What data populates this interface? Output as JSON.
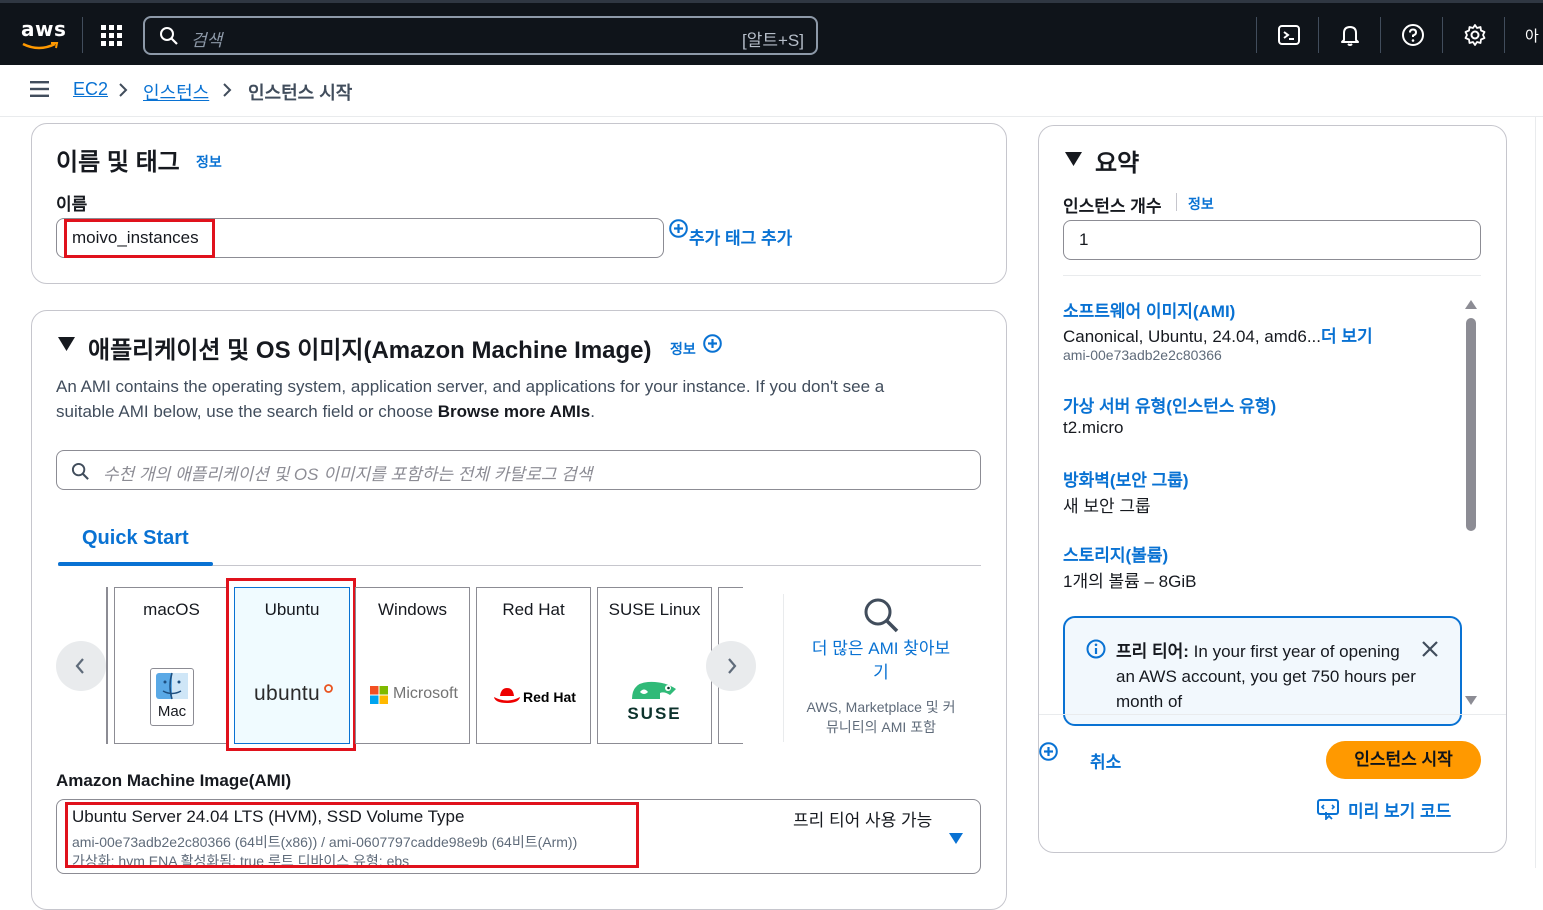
{
  "topbar": {
    "logo": "aws",
    "search_placeholder": "검색",
    "search_shortcut": "[알트+S]",
    "icons": [
      "grid-icon",
      "cloudshell-icon",
      "bell-icon",
      "help-icon",
      "gear-icon"
    ],
    "account_truncated": "아"
  },
  "breadcrumb": {
    "items": [
      "EC2",
      "인스턴스",
      "인스턴스 시작"
    ]
  },
  "name_tags": {
    "title": "이름 및 태그",
    "info": "정보",
    "name_label": "이름",
    "name_value": "moivo_instances",
    "add_tag": "추가 태그 추가"
  },
  "ami_section": {
    "title": "애플리케이션 및 OS 이미지(Amazon Machine Image)",
    "info": "정보",
    "description_1": "An AMI contains the operating system, application server, and applications for your instance. If you don't see a",
    "description_2a": "suitable AMI below, use the search field or choose ",
    "description_2b": "Browse more AMIs",
    "description_2c": ".",
    "search_placeholder": "수천 개의 애플리케이션 및 OS 이미지를 포함하는 전체 카탈로그 검색",
    "tab": "Quick Start",
    "os_cards": [
      {
        "name": "macOS",
        "logo": "Mac"
      },
      {
        "name": "Ubuntu",
        "logo": "ubuntu"
      },
      {
        "name": "Windows",
        "logo": "Microsoft"
      },
      {
        "name": "Red Hat",
        "logo": "Red Hat"
      },
      {
        "name": "SUSE Linux",
        "logo": "SUSE"
      }
    ],
    "more_amis": "더 많은 AMI 찾아보기",
    "more_amis_sub": "AWS, Marketplace 및 커뮤니티의 AMI 포함",
    "ami_label": "Amazon Machine Image(AMI)",
    "ami_title": "Ubuntu Server 24.04 LTS (HVM), SSD Volume Type",
    "ami_ids": "ami-00e73adb2e2c80366 (64비트(x86)) / ami-0607797cadde98e9b (64비트(Arm))",
    "ami_details": "가상화: hvm    ENA 활성화됨: true    루트 디바이스 유형: ebs",
    "ami_free_tier": "프리 티어 사용 가능"
  },
  "summary": {
    "title": "요약",
    "instance_count_label": "인스턴스 개수",
    "info": "정보",
    "instance_count": "1",
    "software_image_label": "소프트웨어 이미지(AMI)",
    "software_image_value": "Canonical, Ubuntu, 24.04, amd6...",
    "see_more": "더 보기",
    "software_image_id": "ami-00e73adb2e2c80366",
    "instance_type_label": "가상 서버 유형(인스턴스 유형)",
    "instance_type_value": "t2.micro",
    "firewall_label": "방화벽(보안 그룹)",
    "firewall_value": "새 보안 그룹",
    "storage_label": "스토리지(볼륨)",
    "storage_value": "1개의 볼륨 – 8GiB",
    "alert_bold": "프리 티어:",
    "alert_text": " In your first year of opening an AWS account, you get 750 hours per month of",
    "cancel": "취소",
    "launch": "인스턴스 시작",
    "preview_code": "미리 보기 코드"
  },
  "colors": {
    "topbar": "#0f141a",
    "link": "#0972d3",
    "primary_button": "#ff9900",
    "highlight": "#e0121c"
  }
}
